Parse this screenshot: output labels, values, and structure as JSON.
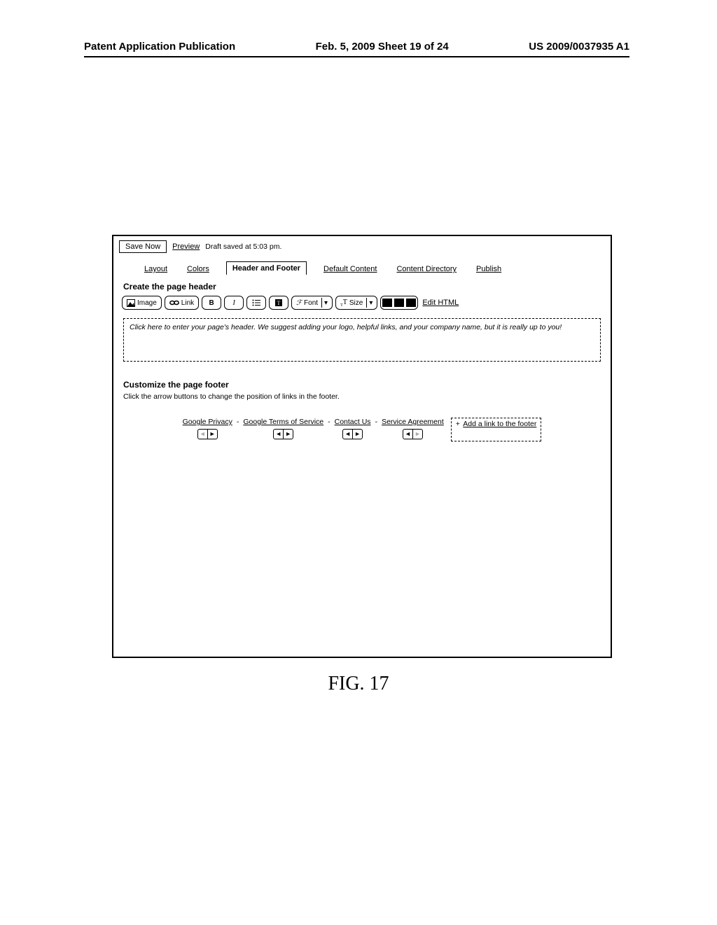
{
  "doc_header": {
    "left": "Patent Application Publication",
    "center": "Feb. 5, 2009  Sheet 19 of 24",
    "right": "US 2009/0037935 A1"
  },
  "topbar": {
    "save_label": "Save Now",
    "preview_label": "Preview",
    "draft_status": "Draft saved at 5:03 pm."
  },
  "tabs": {
    "layout": "Layout",
    "colors": "Colors",
    "header_footer": "Header and Footer",
    "default_content": "Default Content",
    "content_directory": "Content Directory",
    "publish": "Publish"
  },
  "header_section": {
    "title": "Create the page header",
    "toolbar": {
      "image": "Image",
      "link": "Link",
      "bold": "B",
      "italic": "I",
      "font_label": "Font",
      "size_label": "Size",
      "edit_html": "Edit HTML"
    },
    "placeholder_text": "Click here to enter your page's header. We suggest adding your logo, helpful links, and your company name, but it is really up to you!"
  },
  "footer_section": {
    "title": "Customize the page footer",
    "subtitle": "Click the arrow buttons to change the position of links in the footer.",
    "links": [
      "Google Privacy",
      "Google Terms of Service",
      "Contact Us",
      "Service Agreement"
    ],
    "add_link_prefix": "+",
    "add_link_label": "Add a link to the footer",
    "arrow_left": "◄",
    "arrow_right": "►"
  },
  "figure_caption": "FIG. 17"
}
